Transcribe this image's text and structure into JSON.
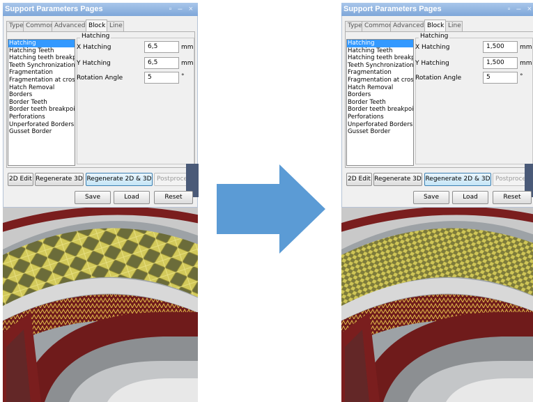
{
  "panels": [
    {
      "title": "Support Parameters Pages",
      "title_controls": "▫ – ×",
      "tabs": [
        "Type",
        "Common",
        "Advanced",
        "Block",
        "Line"
      ],
      "active_tab": "Block",
      "list_items": [
        "Hatching",
        "Hatching Teeth",
        "Hatching teeth breakpo",
        "Teeth Synchronization",
        "Fragmentation",
        "Fragmentation at cross",
        "Hatch Removal",
        "Borders",
        "Border Teeth",
        "Border teeth breakpoir",
        "Perforations",
        "Unperforated Borders",
        "Gusset Border"
      ],
      "selected_item": "Hatching",
      "group_label": "Hatching",
      "fields": [
        {
          "label": "X Hatching",
          "value": "6,5",
          "unit": "mm"
        },
        {
          "label": "Y Hatching",
          "value": "6,5",
          "unit": "mm"
        },
        {
          "label": "Rotation Angle",
          "value": "5",
          "unit": "°"
        }
      ],
      "buttons_row1": [
        "2D Edit",
        "Regenerate 3D",
        "Regenerate 2D & 3D",
        "Postproce"
      ],
      "buttons_row2": [
        "Save",
        "Load",
        "Reset"
      ]
    },
    {
      "title": "Support Parameters Pages",
      "title_controls": "▫ – ×",
      "tabs": [
        "Type",
        "Common",
        "Advanced",
        "Block",
        "Line"
      ],
      "active_tab": "Block",
      "list_items": [
        "Hatching",
        "Hatching Teeth",
        "Hatching teeth breakpo",
        "Teeth Synchronization",
        "Fragmentation",
        "Fragmentation at cross",
        "Hatch Removal",
        "Borders",
        "Border Teeth",
        "Border teeth breakpoir",
        "Perforations",
        "Unperforated Borders",
        "Gusset Border"
      ],
      "selected_item": "Hatching",
      "group_label": "Hatching",
      "fields": [
        {
          "label": "X Hatching",
          "value": "1,500",
          "unit": "mm"
        },
        {
          "label": "Y Hatching",
          "value": "1,500",
          "unit": "mm"
        },
        {
          "label": "Rotation Angle",
          "value": "5",
          "unit": "°"
        }
      ],
      "buttons_row1": [
        "2D Edit",
        "Regenerate 3D",
        "Regenerate 2D & 3D",
        "Postproce"
      ],
      "buttons_row2": [
        "Save",
        "Load",
        "Reset"
      ]
    }
  ],
  "colors": {
    "title_bar": "#8fb2df",
    "selection": "#3399ff",
    "arrow": "#5b9bd5",
    "support_structure": "#c8c04a",
    "part_red": "#7a1e1e",
    "plate_gray": "#9aa0a4"
  },
  "icons": {
    "arrow": "right-arrow-icon"
  },
  "views": [
    "coarse-hatching-3d-preview",
    "fine-hatching-3d-preview"
  ]
}
